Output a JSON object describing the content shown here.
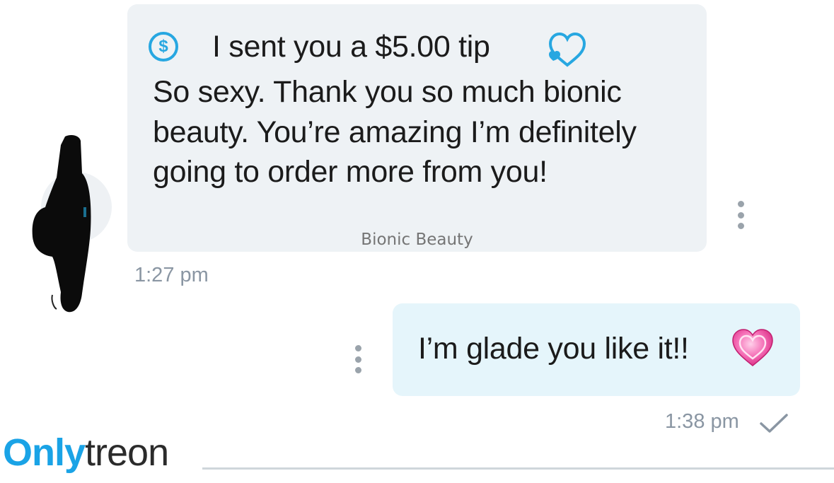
{
  "incoming": {
    "tip_label": "I sent you a $5.00 tip",
    "message": "So sexy. Thank you so much bionic beauty. You’re amazing I’m definitely going to order more from you!",
    "sender": "Bionic Beauty",
    "time": "1:27 pm"
  },
  "outgoing": {
    "message": "I’m glade you like it!!",
    "time": "1:38 pm"
  },
  "watermark": {
    "part1": "Only",
    "part2": "treon"
  },
  "colors": {
    "accent": "#27a7e1",
    "incoming_bubble": "#eef2f5",
    "outgoing_bubble": "#e5f5fb",
    "timestamp": "#8a96a3"
  },
  "icons": {
    "tip": "dollar-circle-icon",
    "tip_heart": "heart-outline-icon",
    "reaction": "pink-heart-icon",
    "status": "check-icon",
    "more": "more-vertical-icon"
  }
}
